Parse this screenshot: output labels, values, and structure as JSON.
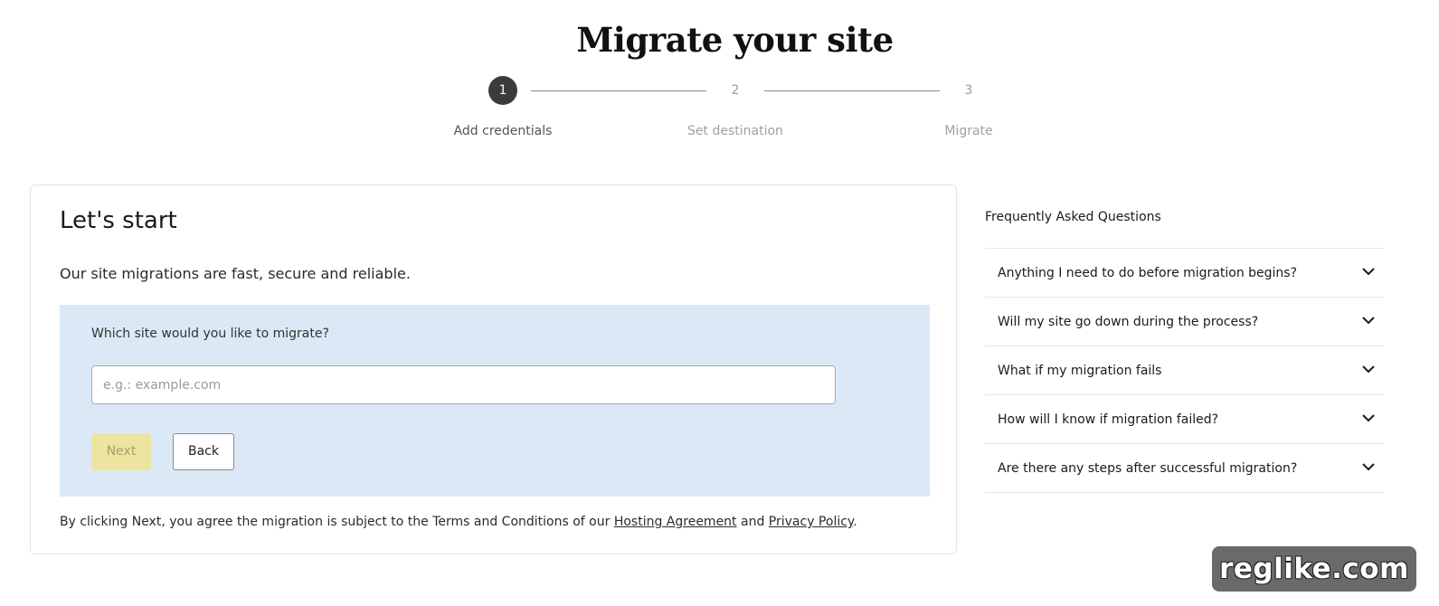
{
  "header": {
    "title": "Migrate your site"
  },
  "stepper": {
    "steps": [
      {
        "number": "1",
        "label": "Add credentials",
        "state": "active"
      },
      {
        "number": "2",
        "label": "Set destination",
        "state": "inactive"
      },
      {
        "number": "3",
        "label": "Migrate",
        "state": "inactive"
      }
    ]
  },
  "form": {
    "heading": "Let's start",
    "subheading": "Our site migrations are fast, secure and reliable.",
    "question": "Which site would you like to migrate?",
    "site_input": {
      "placeholder": "e.g.: example.com",
      "value": ""
    },
    "next_label": "Next",
    "back_label": "Back",
    "terms": {
      "prefix": "By clicking Next, you agree the migration is subject to the Terms and Conditions of our ",
      "hosting_link": "Hosting Agreement",
      "middle": " and ",
      "privacy_link": "Privacy Policy",
      "suffix": "."
    }
  },
  "faq": {
    "title": "Frequently Asked Questions",
    "items": [
      {
        "question": "Anything I need to do before migration begins?"
      },
      {
        "question": "Will my site go down during the process?"
      },
      {
        "question": "What if my migration fails"
      },
      {
        "question": "How will I know if migration failed?"
      },
      {
        "question": "Are there any steps after successful migration?"
      }
    ]
  },
  "watermark": {
    "text": "reglike.com"
  },
  "colors": {
    "panel_bg": "#dbe9f7",
    "next_button_bg": "#ede49f",
    "active_step": "#3b3b3b"
  }
}
